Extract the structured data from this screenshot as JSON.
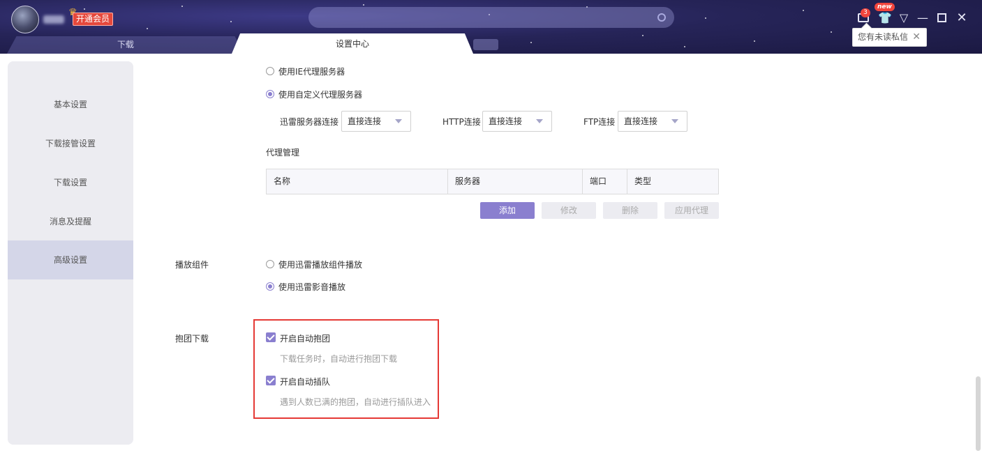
{
  "header": {
    "username": "",
    "vip_button": "开通会员",
    "search_text": "",
    "tabs": [
      {
        "label": "下载"
      },
      {
        "label": "设置中心"
      }
    ],
    "mail_count": "3",
    "new_badge": "new",
    "tooltip": "您有未读私信",
    "colors": {
      "accent": "#8a7fcf",
      "header_bg": "#262458",
      "badge": "#f2453d"
    }
  },
  "sidebar": {
    "items": [
      {
        "label": "基本设置",
        "active": false
      },
      {
        "label": "下载接管设置",
        "active": false
      },
      {
        "label": "下载设置",
        "active": false
      },
      {
        "label": "消息及提醒",
        "active": false
      },
      {
        "label": "高级设置",
        "active": true
      }
    ]
  },
  "proxy": {
    "option_ie": "使用IE代理服务器",
    "option_custom": "使用自定义代理服务器",
    "selected": "custom",
    "xunlei_label": "迅雷服务器连接",
    "xunlei_value": "直接连接",
    "http_label": "HTTP连接",
    "http_value": "直接连接",
    "ftp_label": "FTP连接",
    "ftp_value": "直接连接",
    "manage_title": "代理管理",
    "table_headers": [
      "名称",
      "服务器",
      "端口",
      "类型"
    ],
    "buttons": {
      "add": "添加",
      "edit": "修改",
      "delete": "删除",
      "apply": "应用代理"
    }
  },
  "player": {
    "section_label": "播放组件",
    "option_component": "使用迅雷播放组件播放",
    "option_video": "使用迅雷影音播放",
    "selected": "video"
  },
  "group_download": {
    "section_label": "抱团下载",
    "auto_group_label": "开启自动抱团",
    "auto_group_hint": "下载任务时，自动进行抱团下载",
    "auto_group_checked": true,
    "auto_queue_label": "开启自动插队",
    "auto_queue_hint": "遇到人数已满的抱团，自动进行插队进入",
    "auto_queue_checked": true
  }
}
